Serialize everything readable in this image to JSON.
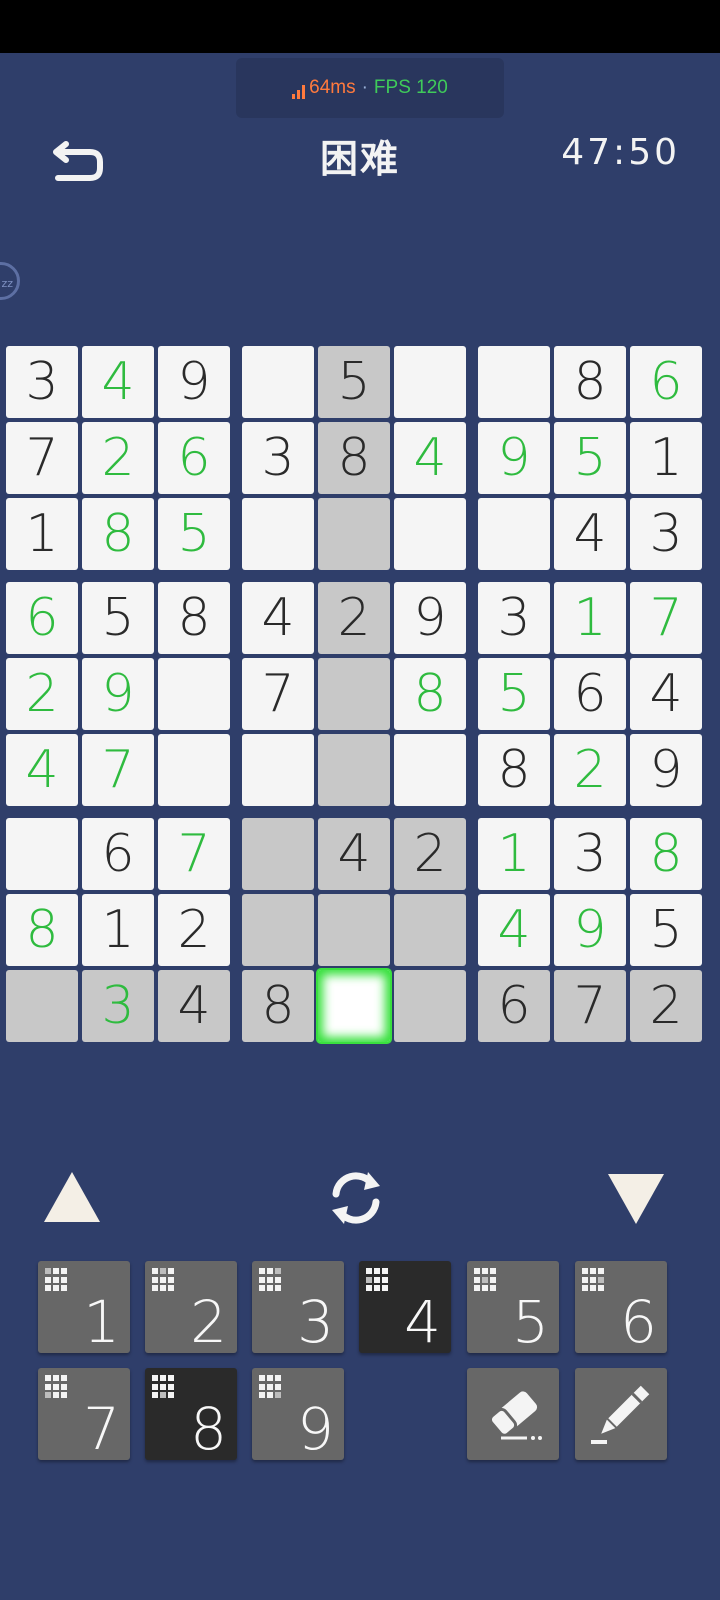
{
  "perf": {
    "ping": "64ms",
    "separator": "·",
    "fps": "FPS 120"
  },
  "header": {
    "title": "困难",
    "timer": "47:50",
    "back_icon": "back-arrow-icon"
  },
  "side_badge": {
    "text": "zz"
  },
  "colors": {
    "background": "#2f3e6a",
    "user_digit": "#2fbb3f",
    "given_digit": "#2a2a2a",
    "selection": "#34e03a"
  },
  "board": {
    "rows": [
      [
        "3",
        "4",
        "9",
        "",
        "5",
        "",
        "",
        "8",
        "6"
      ],
      [
        "7",
        "2",
        "6",
        "3",
        "8",
        "4",
        "9",
        "5",
        "1"
      ],
      [
        "1",
        "8",
        "5",
        "",
        "",
        "",
        "",
        "4",
        "3"
      ],
      [
        "6",
        "5",
        "8",
        "4",
        "2",
        "9",
        "3",
        "1",
        "7"
      ],
      [
        "2",
        "9",
        "",
        "7",
        "",
        "8",
        "5",
        "6",
        "4"
      ],
      [
        "4",
        "7",
        "",
        "",
        "",
        "",
        "8",
        "2",
        "9"
      ],
      [
        "",
        "6",
        "7",
        "",
        "4",
        "2",
        "1",
        "3",
        "8"
      ],
      [
        "8",
        "1",
        "2",
        "",
        "",
        "",
        "4",
        "9",
        "5"
      ],
      [
        "",
        "3",
        "4",
        "8",
        "",
        "",
        "6",
        "7",
        "2"
      ]
    ],
    "user_entered": [
      [
        0,
        1
      ],
      [
        0,
        8
      ],
      [
        1,
        1
      ],
      [
        1,
        2
      ],
      [
        1,
        5
      ],
      [
        1,
        6
      ],
      [
        1,
        7
      ],
      [
        2,
        1
      ],
      [
        2,
        2
      ],
      [
        3,
        0
      ],
      [
        3,
        7
      ],
      [
        3,
        8
      ],
      [
        4,
        0
      ],
      [
        4,
        1
      ],
      [
        4,
        5
      ],
      [
        4,
        6
      ],
      [
        5,
        0
      ],
      [
        5,
        1
      ],
      [
        5,
        7
      ],
      [
        6,
        2
      ],
      [
        6,
        6
      ],
      [
        6,
        8
      ],
      [
        7,
        0
      ],
      [
        7,
        6
      ],
      [
        7,
        7
      ],
      [
        8,
        1
      ]
    ],
    "highlighted": [
      [
        0,
        4
      ],
      [
        1,
        4
      ],
      [
        2,
        4
      ],
      [
        3,
        4
      ],
      [
        4,
        4
      ],
      [
        5,
        4
      ],
      [
        6,
        3
      ],
      [
        6,
        4
      ],
      [
        6,
        5
      ],
      [
        7,
        3
      ],
      [
        7,
        4
      ],
      [
        7,
        5
      ],
      [
        8,
        0
      ],
      [
        8,
        1
      ],
      [
        8,
        2
      ],
      [
        8,
        3
      ],
      [
        8,
        5
      ],
      [
        8,
        6
      ],
      [
        8,
        7
      ],
      [
        8,
        8
      ]
    ],
    "selected": [
      8,
      4
    ]
  },
  "controls": {
    "up_icon": "triangle-up-icon",
    "rotate_icon": "rotate-icon",
    "down_icon": "triangle-down-icon",
    "numbers": [
      {
        "digit": "1",
        "active": false
      },
      {
        "digit": "2",
        "active": false
      },
      {
        "digit": "3",
        "active": false
      },
      {
        "digit": "4",
        "active": true
      },
      {
        "digit": "5",
        "active": false
      },
      {
        "digit": "6",
        "active": false
      },
      {
        "digit": "7",
        "active": false
      },
      {
        "digit": "8",
        "active": true
      },
      {
        "digit": "9",
        "active": false
      }
    ],
    "eraser_icon": "eraser-icon",
    "pencil_icon": "pencil-icon"
  }
}
